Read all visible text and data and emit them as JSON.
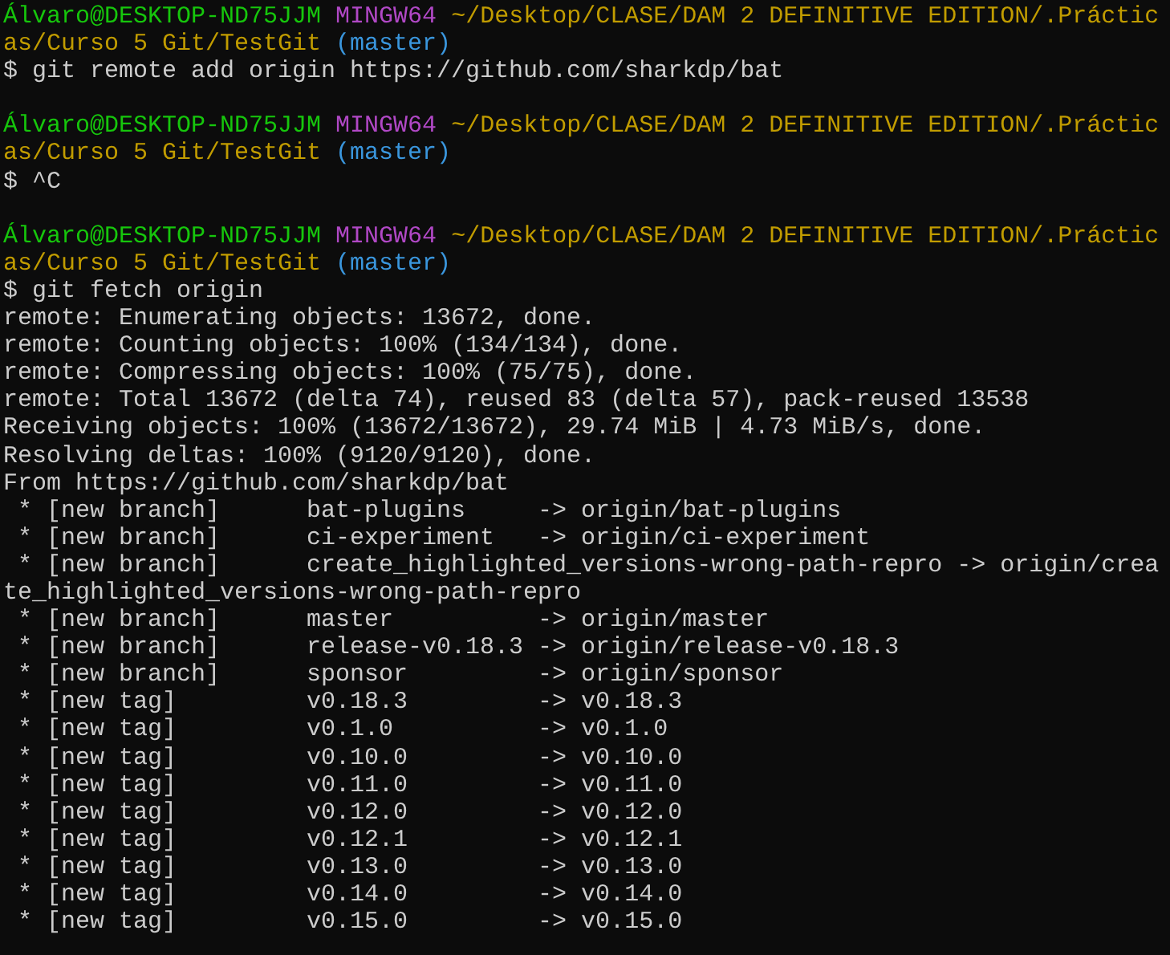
{
  "terminal": {
    "lines": [
      {
        "kind": "text",
        "segments": [
          {
            "text": "Álvaro@DESKTOP-ND75JJM",
            "color": "#16c60c"
          },
          {
            "text": " MINGW64",
            "color": "#b148c6"
          },
          {
            "text": " ~/Desktop/CLASE/DAM 2 DEFINITIVE EDITION/.Práctic",
            "color": "#c19c00"
          }
        ]
      },
      {
        "kind": "text",
        "segments": [
          {
            "text": "as/Curso 5 Git/TestGit",
            "color": "#c19c00"
          },
          {
            "text": " (master)",
            "color": "#3a96dd"
          }
        ]
      },
      {
        "kind": "text",
        "segments": [
          {
            "text": "$ git remote add origin https://github.com/sharkdp/bat",
            "color": "#cccccc"
          }
        ]
      },
      {
        "kind": "blank"
      },
      {
        "kind": "text",
        "segments": [
          {
            "text": "Álvaro@DESKTOP-ND75JJM",
            "color": "#16c60c"
          },
          {
            "text": " MINGW64",
            "color": "#b148c6"
          },
          {
            "text": " ~/Desktop/CLASE/DAM 2 DEFINITIVE EDITION/.Práctic",
            "color": "#c19c00"
          }
        ]
      },
      {
        "kind": "text",
        "segments": [
          {
            "text": "as/Curso 5 Git/TestGit",
            "color": "#c19c00"
          },
          {
            "text": " (master)",
            "color": "#3a96dd"
          }
        ]
      },
      {
        "kind": "text",
        "segments": [
          {
            "text": "$ ^C",
            "color": "#cccccc"
          }
        ]
      },
      {
        "kind": "blank"
      },
      {
        "kind": "text",
        "segments": [
          {
            "text": "Álvaro@DESKTOP-ND75JJM",
            "color": "#16c60c"
          },
          {
            "text": " MINGW64",
            "color": "#b148c6"
          },
          {
            "text": " ~/Desktop/CLASE/DAM 2 DEFINITIVE EDITION/.Práctic",
            "color": "#c19c00"
          }
        ]
      },
      {
        "kind": "text",
        "segments": [
          {
            "text": "as/Curso 5 Git/TestGit",
            "color": "#c19c00"
          },
          {
            "text": " (master)",
            "color": "#3a96dd"
          }
        ]
      },
      {
        "kind": "text",
        "segments": [
          {
            "text": "$ git fetch origin",
            "color": "#cccccc"
          }
        ]
      },
      {
        "kind": "text",
        "segments": [
          {
            "text": "remote: Enumerating objects: 13672, done.",
            "color": "#cccccc"
          }
        ]
      },
      {
        "kind": "text",
        "segments": [
          {
            "text": "remote: Counting objects: 100% (134/134), done.",
            "color": "#cccccc"
          }
        ]
      },
      {
        "kind": "text",
        "segments": [
          {
            "text": "remote: Compressing objects: 100% (75/75), done.",
            "color": "#cccccc"
          }
        ]
      },
      {
        "kind": "text",
        "segments": [
          {
            "text": "remote: Total 13672 (delta 74), reused 83 (delta 57), pack-reused 13538",
            "color": "#cccccc"
          }
        ]
      },
      {
        "kind": "text",
        "segments": [
          {
            "text": "Receiving objects: 100% (13672/13672), 29.74 MiB | 4.73 MiB/s, done.",
            "color": "#cccccc"
          }
        ]
      },
      {
        "kind": "text",
        "segments": [
          {
            "text": "Resolving deltas: 100% (9120/9120), done.",
            "color": "#cccccc"
          }
        ]
      },
      {
        "kind": "text",
        "segments": [
          {
            "text": "From https://github.com/sharkdp/bat",
            "color": "#cccccc"
          }
        ]
      },
      {
        "kind": "text",
        "segments": [
          {
            "text": " * [new branch]      bat-plugins     -> origin/bat-plugins",
            "color": "#cccccc"
          }
        ]
      },
      {
        "kind": "text",
        "segments": [
          {
            "text": " * [new branch]      ci-experiment   -> origin/ci-experiment",
            "color": "#cccccc"
          }
        ]
      },
      {
        "kind": "text",
        "segments": [
          {
            "text": " * [new branch]      create_highlighted_versions-wrong-path-repro -> origin/crea",
            "color": "#cccccc"
          }
        ]
      },
      {
        "kind": "text",
        "segments": [
          {
            "text": "te_highlighted_versions-wrong-path-repro",
            "color": "#cccccc"
          }
        ]
      },
      {
        "kind": "text",
        "segments": [
          {
            "text": " * [new branch]      master          -> origin/master",
            "color": "#cccccc"
          }
        ]
      },
      {
        "kind": "text",
        "segments": [
          {
            "text": " * [new branch]      release-v0.18.3 -> origin/release-v0.18.3",
            "color": "#cccccc"
          }
        ]
      },
      {
        "kind": "text",
        "segments": [
          {
            "text": " * [new branch]      sponsor         -> origin/sponsor",
            "color": "#cccccc"
          }
        ]
      },
      {
        "kind": "text",
        "segments": [
          {
            "text": " * [new tag]         v0.18.3         -> v0.18.3",
            "color": "#cccccc"
          }
        ]
      },
      {
        "kind": "text",
        "segments": [
          {
            "text": " * [new tag]         v0.1.0          -> v0.1.0",
            "color": "#cccccc"
          }
        ]
      },
      {
        "kind": "text",
        "segments": [
          {
            "text": " * [new tag]         v0.10.0         -> v0.10.0",
            "color": "#cccccc"
          }
        ]
      },
      {
        "kind": "text",
        "segments": [
          {
            "text": " * [new tag]         v0.11.0         -> v0.11.0",
            "color": "#cccccc"
          }
        ]
      },
      {
        "kind": "text",
        "segments": [
          {
            "text": " * [new tag]         v0.12.0         -> v0.12.0",
            "color": "#cccccc"
          }
        ]
      },
      {
        "kind": "text",
        "segments": [
          {
            "text": " * [new tag]         v0.12.1         -> v0.12.1",
            "color": "#cccccc"
          }
        ]
      },
      {
        "kind": "text",
        "segments": [
          {
            "text": " * [new tag]         v0.13.0         -> v0.13.0",
            "color": "#cccccc"
          }
        ]
      },
      {
        "kind": "text",
        "segments": [
          {
            "text": " * [new tag]         v0.14.0         -> v0.14.0",
            "color": "#cccccc"
          }
        ]
      },
      {
        "kind": "text",
        "segments": [
          {
            "text": " * [new tag]         v0.15.0         -> v0.15.0",
            "color": "#cccccc"
          }
        ]
      }
    ]
  }
}
